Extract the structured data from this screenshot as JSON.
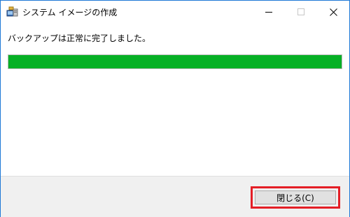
{
  "window": {
    "title": "システム イメージの作成",
    "controls": [
      "minimize-icon",
      "maximize-icon",
      "close-icon"
    ]
  },
  "content": {
    "message": "バックアップは正常に完了しました。",
    "progress_percent": 100,
    "progress_color": "#06b025"
  },
  "footer": {
    "close_label": "閉じる(C)",
    "highlight_color": "#e41e26"
  }
}
